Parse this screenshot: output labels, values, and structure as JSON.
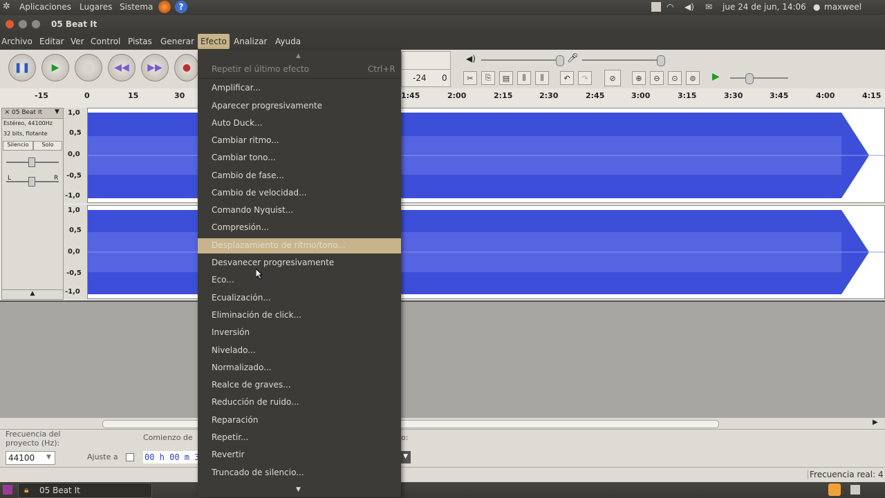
{
  "top_panel": {
    "menus": [
      "Aplicaciones",
      "Lugares",
      "Sistema"
    ],
    "clock": "jue 24 de jun, 14:06",
    "user": "maxweel"
  },
  "window": {
    "title": "05 Beat It"
  },
  "menubar": {
    "items": [
      "Archivo",
      "Editar",
      "Ver",
      "Control",
      "Pistas",
      "Generar",
      "Efecto",
      "Analizar",
      "Ayuda"
    ],
    "active": "Efecto"
  },
  "toolbar": {
    "meter_labels": [
      "-24",
      "0"
    ]
  },
  "ruler": {
    "ticks_left": [
      "-15",
      "0",
      "15",
      "30"
    ],
    "ticks_right": [
      "1:45",
      "2:00",
      "2:15",
      "2:30",
      "2:45",
      "3:00",
      "3:15",
      "3:30",
      "3:45",
      "4:00",
      "4:15"
    ]
  },
  "track": {
    "name": "05 Beat It",
    "format": "Estéreo, 44100Hz",
    "bits": "32 bits, flotante",
    "mute_label": "Silencio",
    "solo_label": "Solo",
    "pan_left": "L",
    "pan_right": "R",
    "scale_top": [
      "1,0",
      "0,5",
      "0,0",
      "-0,5",
      "-1,0"
    ],
    "scale_bottom": [
      "1,0",
      "0,5",
      "0,0",
      "-0,5",
      "-1,0"
    ],
    "wave_color": "#3d4fd9"
  },
  "selection_bar": {
    "rate_label": "Frecuencia del proyecto (Hz):",
    "rate_value": "44100",
    "snap_label": "Ajuste a",
    "start_label": "Comienzo de",
    "start_value": "00 h 00 m 3",
    "right_label": "o:"
  },
  "status_bar": {
    "actual_rate": "Frecuencia real: 4"
  },
  "taskbar": {
    "app": "05 Beat It"
  },
  "effect_menu": {
    "repeat_label": "Repetir el último efecto",
    "repeat_shortcut": "Ctrl+R",
    "items": [
      "Amplificar...",
      "Aparecer progresivamente",
      "Auto Duck...",
      "Cambiar ritmo...",
      "Cambiar tono...",
      "Cambio de fase...",
      "Cambio de velocidad...",
      "Comando Nyquist...",
      "Compresión...",
      "Desplazamiento de ritmo/tono...",
      "Desvanecer progresivamente",
      "Eco...",
      "Ecualización...",
      "Eliminación de click...",
      "Inversión",
      "Nivelado...",
      "Normalizado...",
      "Realce de graves...",
      "Reducción de ruido...",
      "Reparación",
      "Repetir...",
      "Revertir",
      "Truncado de silencio..."
    ],
    "highlighted": "Desplazamiento de ritmo/tono...",
    "highlight_color": "#c8b48a"
  }
}
